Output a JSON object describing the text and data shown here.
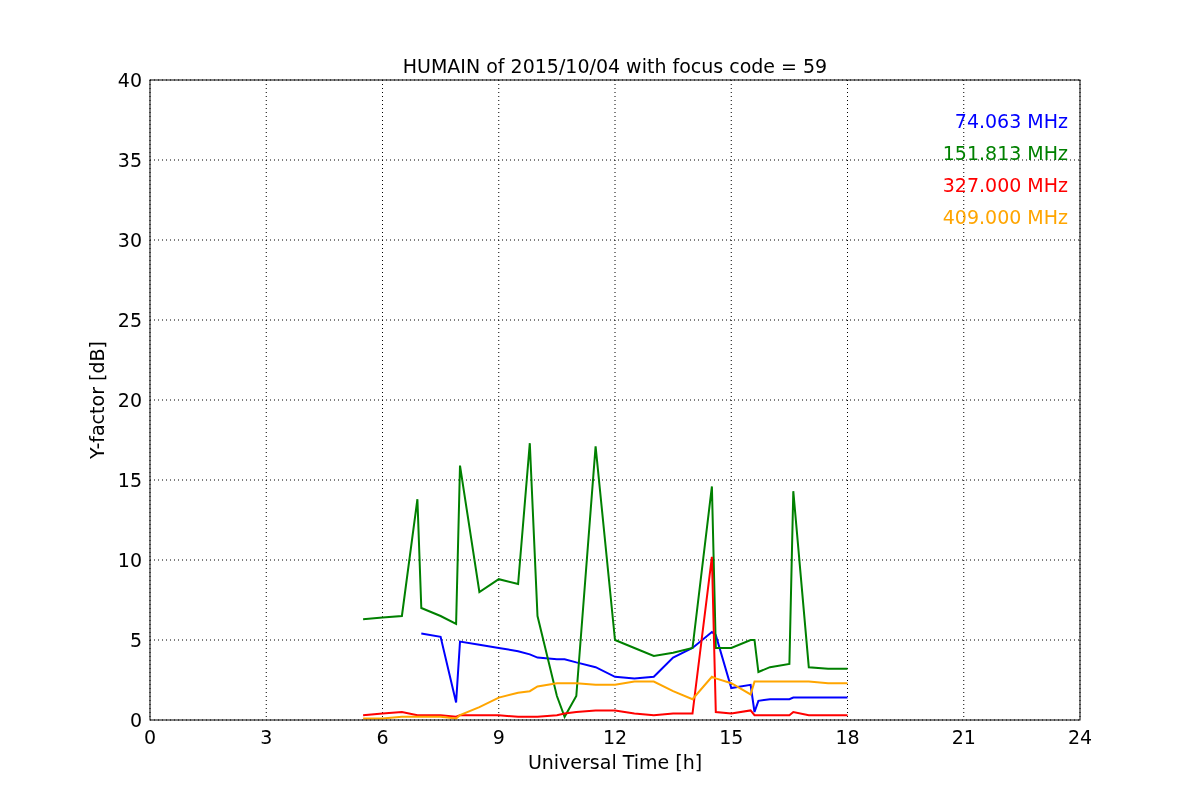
{
  "figure": {
    "chart_data": {
      "type": "line",
      "title": "HUMAIN of 2015/10/04 with focus code = 59",
      "xlabel": "Universal Time [h]",
      "ylabel": "Y-factor [dB]",
      "x": [
        5.5,
        6,
        6.5,
        6.9,
        7,
        7.5,
        7.9,
        8,
        8.5,
        9,
        9.5,
        9.8,
        10,
        10.5,
        10.7,
        11,
        11.5,
        12,
        12.5,
        13,
        13.5,
        14,
        14.5,
        14.6,
        15,
        15.5,
        15.6,
        15.7,
        16,
        16.5,
        16.6,
        17,
        17.5,
        18
      ],
      "series": [
        {
          "name": "74.063 MHz",
          "color": "#0000ff",
          "values": [
            null,
            null,
            null,
            null,
            5.4,
            5.2,
            1.1,
            4.9,
            4.7,
            4.5,
            4.3,
            4.1,
            3.9,
            3.8,
            3.8,
            3.6,
            3.3,
            2.7,
            2.6,
            2.7,
            3.9,
            4.5,
            5.5,
            5.3,
            2,
            2.2,
            0.5,
            1.2,
            1.3,
            1.3,
            1.4,
            1.4,
            1.4,
            1.4
          ]
        },
        {
          "name": "151.813 MHz",
          "color": "#008000",
          "values": [
            6.3,
            6.4,
            6.5,
            13.8,
            7,
            6.5,
            6,
            15.9,
            8,
            8.8,
            8.5,
            17.3,
            6.5,
            1.5,
            0.2,
            1.5,
            17.1,
            5,
            4.5,
            4,
            4.2,
            4.5,
            14.6,
            4.5,
            4.5,
            5,
            5,
            3,
            3.3,
            3.5,
            14.3,
            3.3,
            3.2,
            3.2
          ]
        },
        {
          "name": "327.000 MHz",
          "color": "#ff0000",
          "values": [
            0.3,
            0.4,
            0.5,
            0.3,
            0.3,
            0.3,
            0.2,
            0.3,
            0.3,
            0.3,
            0.2,
            0.2,
            0.2,
            0.3,
            0.4,
            0.5,
            0.6,
            0.6,
            0.4,
            0.3,
            0.4,
            0.4,
            10.2,
            0.5,
            0.4,
            0.6,
            0.3,
            0.3,
            0.3,
            0.3,
            0.5,
            0.3,
            0.3,
            0.3
          ]
        },
        {
          "name": "409.000 MHz",
          "color": "#ffa500",
          "values": [
            0.1,
            0.1,
            0.2,
            0.2,
            0.2,
            0.2,
            0.1,
            0.3,
            0.8,
            1.4,
            1.7,
            1.8,
            2.1,
            2.3,
            2.3,
            2.3,
            2.2,
            2.2,
            2.4,
            2.4,
            1.8,
            1.3,
            2.7,
            2.6,
            2.3,
            1.6,
            2.4,
            2.4,
            2.4,
            2.4,
            2.4,
            2.4,
            2.3,
            2.3
          ]
        }
      ],
      "grid": true,
      "xlim": [
        0,
        24
      ],
      "ylim": [
        0,
        40
      ],
      "xticks": [
        0,
        3,
        6,
        9,
        12,
        15,
        18,
        21,
        24
      ],
      "yticks": [
        0,
        5,
        10,
        15,
        20,
        25,
        30,
        35,
        40
      ]
    }
  }
}
